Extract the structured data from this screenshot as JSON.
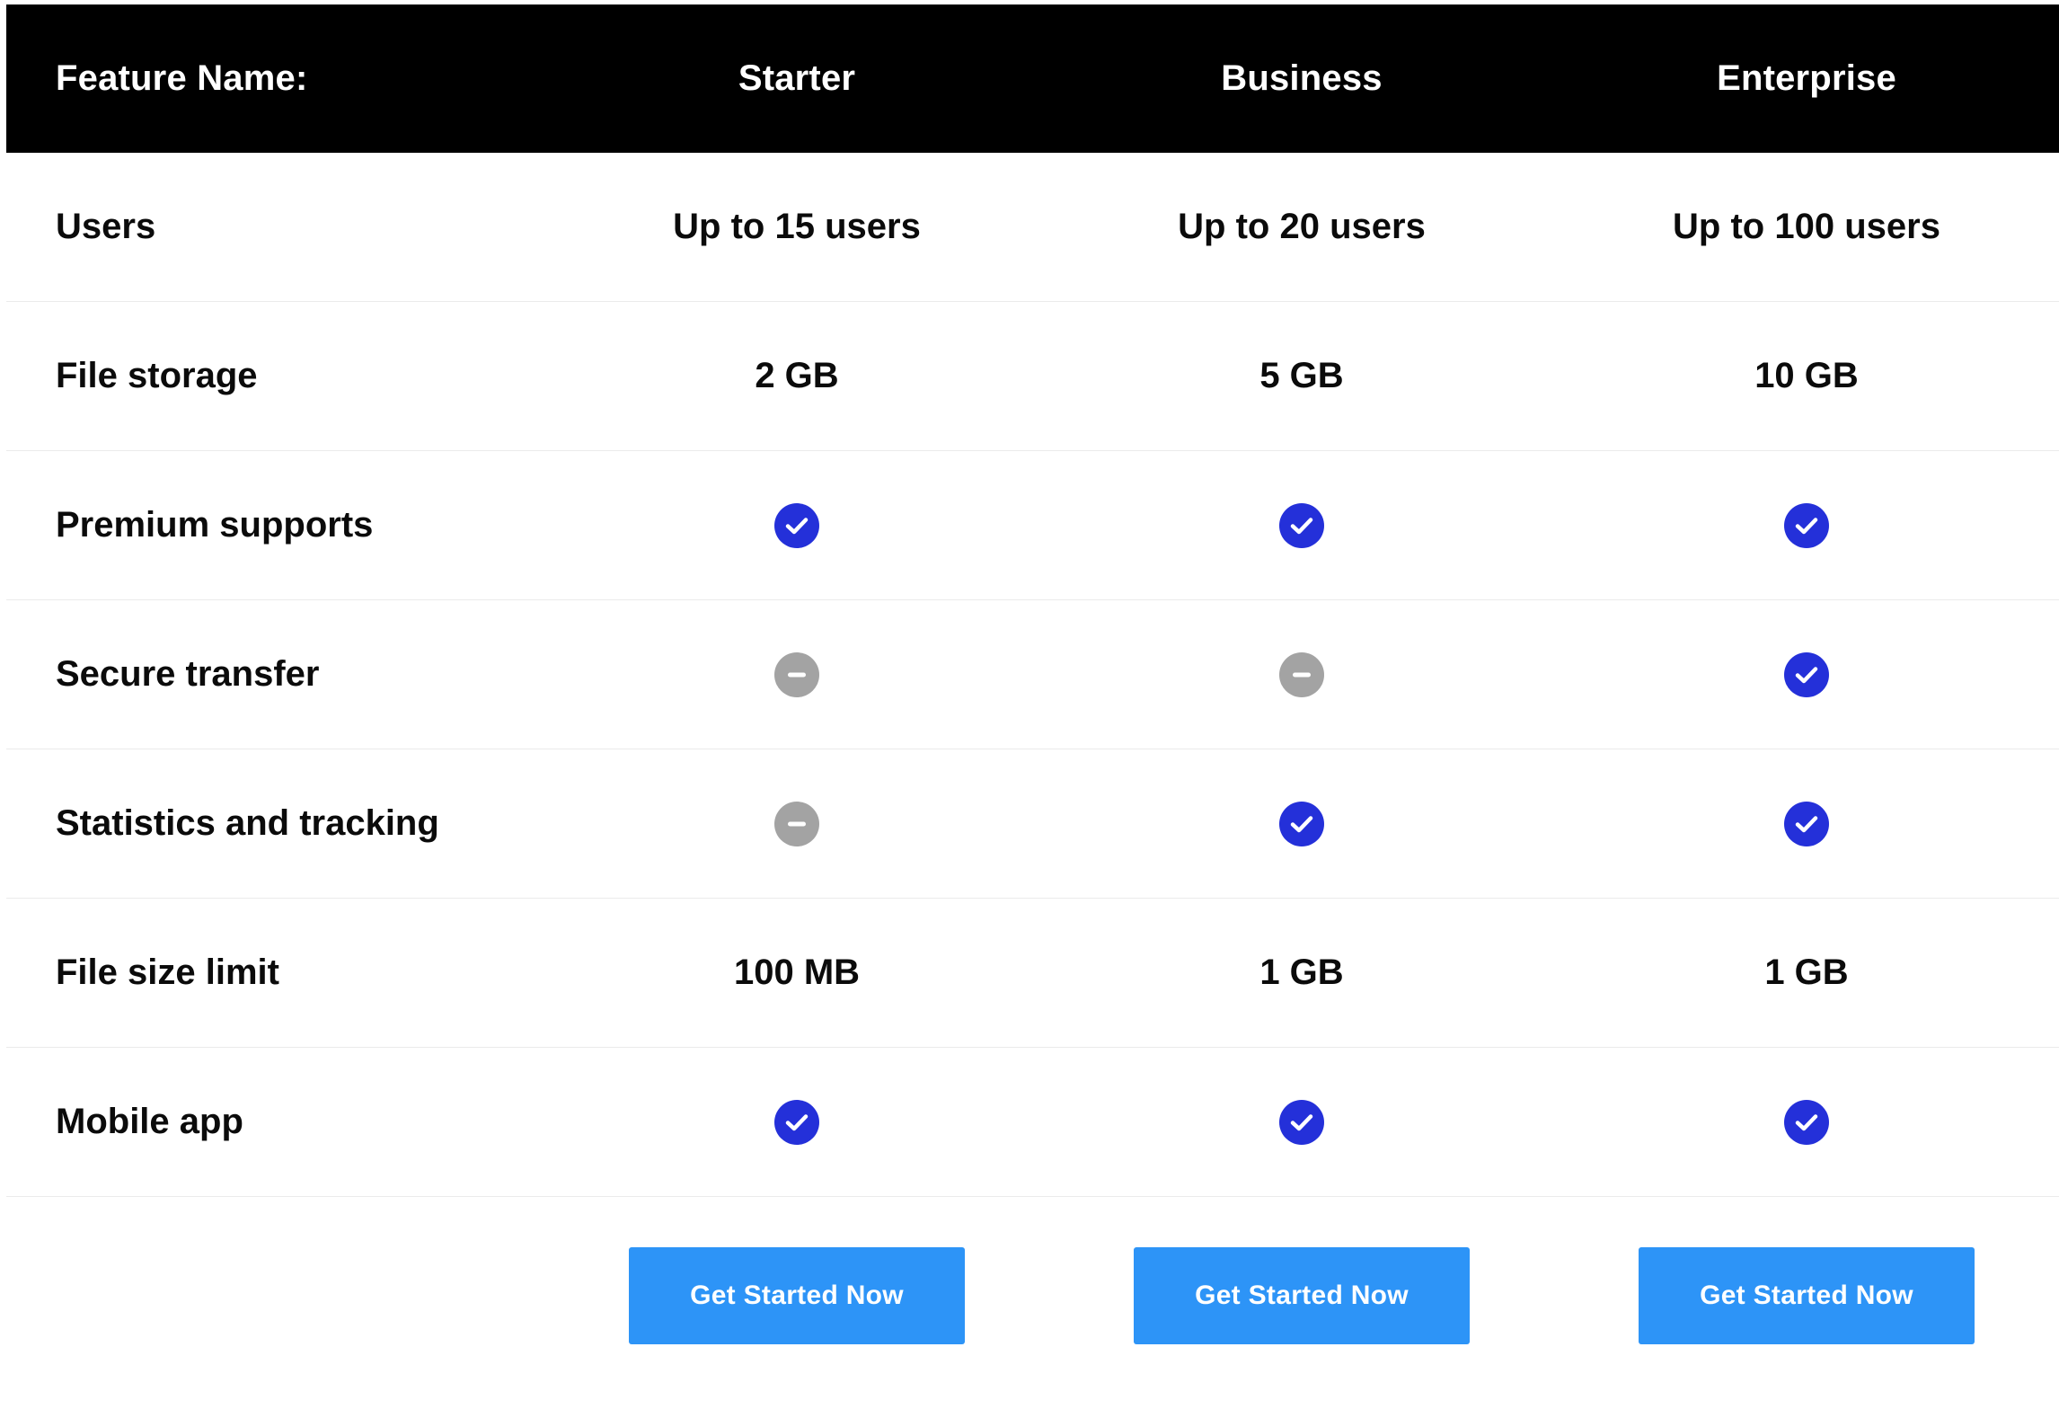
{
  "header": {
    "feature_label": "Feature Name:",
    "plans": [
      "Starter",
      "Business",
      "Enterprise"
    ]
  },
  "colors": {
    "header_bg": "#000000",
    "check": "#2430d9",
    "unavailable": "#a3a3a3",
    "button": "#2d94f7"
  },
  "rows": [
    {
      "feature": "Users",
      "type": "text",
      "values": [
        "Up to 15 users",
        "Up to 20 users",
        "Up to 100 users"
      ]
    },
    {
      "feature": "File storage",
      "type": "text",
      "values": [
        "2 GB",
        "5 GB",
        "10 GB"
      ]
    },
    {
      "feature": "Premium supports",
      "type": "icon",
      "values": [
        "check-icon",
        "check-icon",
        "check-icon"
      ]
    },
    {
      "feature": "Secure transfer",
      "type": "icon",
      "values": [
        "minus-icon",
        "minus-icon",
        "check-icon"
      ]
    },
    {
      "feature": "Statistics and tracking",
      "type": "icon",
      "values": [
        "minus-icon",
        "check-icon",
        "check-icon"
      ]
    },
    {
      "feature": "File size limit",
      "type": "text",
      "values": [
        "100 MB",
        "1 GB",
        "1 GB"
      ]
    },
    {
      "feature": "Mobile app",
      "type": "icon",
      "values": [
        "check-icon",
        "check-icon",
        "check-icon"
      ]
    }
  ],
  "footer": {
    "buttons": [
      "Get Started Now",
      "Get Started Now",
      "Get Started Now"
    ]
  }
}
